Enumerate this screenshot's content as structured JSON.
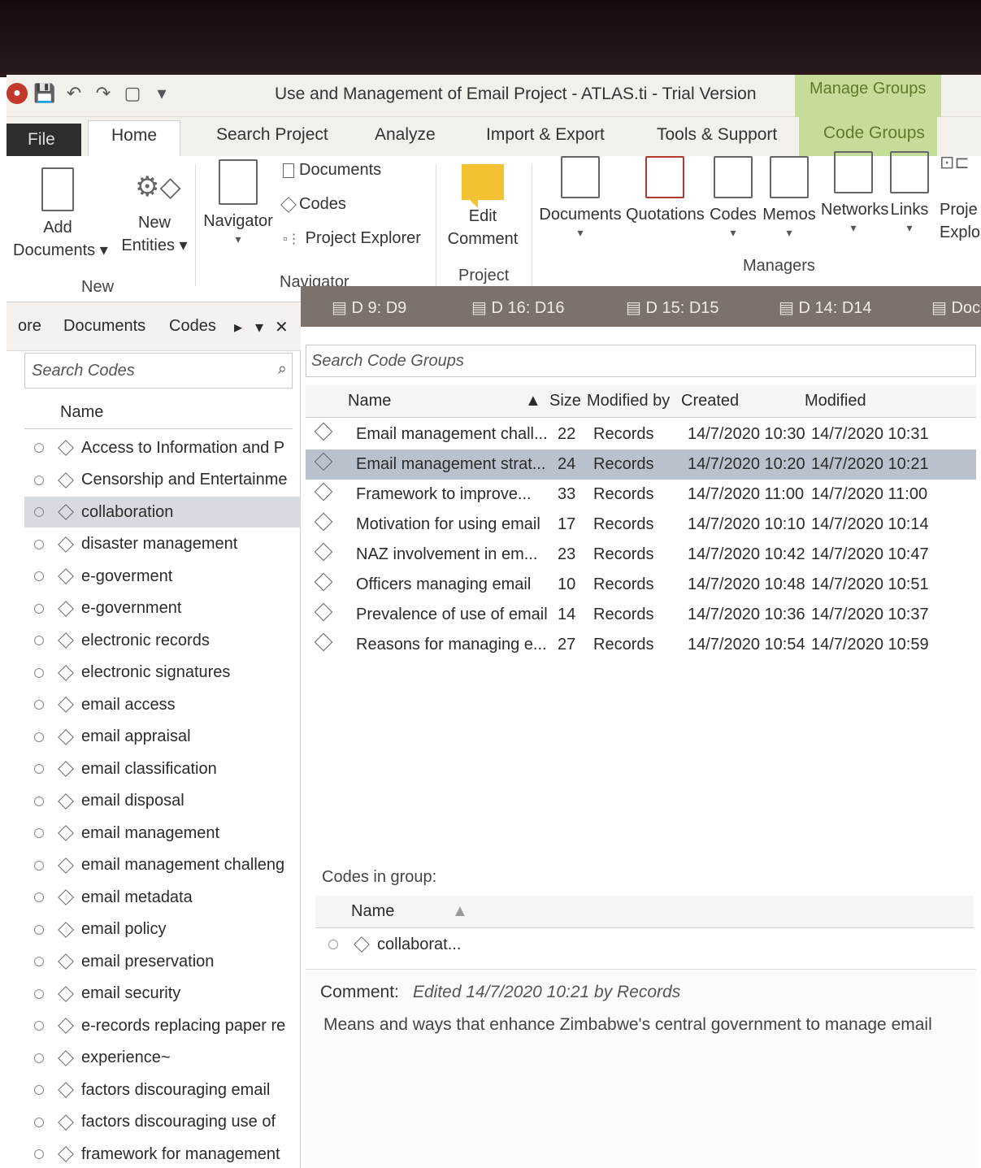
{
  "window": {
    "title": "Use and Management of Email Project - ATLAS.ti - Trial Version",
    "context_label": "Manage Groups"
  },
  "tabs": {
    "file": "File",
    "home": "Home",
    "search_project": "Search Project",
    "analyze": "Analyze",
    "import_export": "Import & Export",
    "tools_support": "Tools & Support",
    "code_groups": "Code Groups"
  },
  "ribbon": {
    "add_documents": "Add",
    "add_documents_2": "Documents",
    "new_entities": "New",
    "new_entities_2": "Entities",
    "group_new": "New",
    "navigator": "Navigator",
    "nav_documents": "Documents",
    "nav_codes": "Codes",
    "nav_project_explorer": "Project Explorer",
    "group_navigator": "Navigator",
    "edit_comment": "Edit",
    "edit_comment_2": "Comment",
    "group_project": "Project",
    "mgr_documents": "Documents",
    "mgr_quotations": "Quotations",
    "mgr_codes": "Codes",
    "mgr_memos": "Memos",
    "mgr_networks": "Networks",
    "mgr_links": "Links",
    "mgr_project_explorer": "Proje",
    "mgr_project_explorer_2": "Explo",
    "group_managers": "Managers"
  },
  "left_pane": {
    "tabs": [
      "ore",
      "Documents",
      "Codes"
    ],
    "search_placeholder": "Search Codes",
    "column_name": "Name",
    "codes": [
      "Access to Information and P",
      "Censorship and Entertainme",
      "collaboration",
      "disaster management",
      "e-goverment",
      "e-government",
      "electronic records",
      "electronic signatures",
      "email access",
      "email appraisal",
      "email classification",
      "email disposal",
      "email management",
      "email management challeng",
      "email metadata",
      "email policy",
      "email preservation",
      "email security",
      "e-records replacing paper re",
      "experience~",
      "factors discouraging email",
      "factors discouraging use of",
      "framework for management"
    ],
    "selected_code": "collaboration"
  },
  "doc_tabs": [
    "D 9: D9",
    "D 16: D16",
    "D 15: D15",
    "D 14: D14",
    "Doc"
  ],
  "manager": {
    "search_placeholder": "Search Code Groups",
    "columns": {
      "name": "Name",
      "size": "Size",
      "modified_by": "Modified by",
      "created": "Created",
      "modified": "Modified"
    },
    "rows": [
      {
        "name": "Email management chall...",
        "size": "22",
        "modified_by": "Records",
        "created": "14/7/2020 10:30",
        "modified": "14/7/2020 10:31"
      },
      {
        "name": "Email management strat...",
        "size": "24",
        "modified_by": "Records",
        "created": "14/7/2020 10:20",
        "modified": "14/7/2020 10:21"
      },
      {
        "name": "Framework to improve...",
        "size": "33",
        "modified_by": "Records",
        "created": "14/7/2020 11:00",
        "modified": "14/7/2020 11:00"
      },
      {
        "name": "Motivation for using email",
        "size": "17",
        "modified_by": "Records",
        "created": "14/7/2020 10:10",
        "modified": "14/7/2020 10:14"
      },
      {
        "name": "NAZ involvement in em...",
        "size": "23",
        "modified_by": "Records",
        "created": "14/7/2020 10:42",
        "modified": "14/7/2020 10:47"
      },
      {
        "name": "Officers managing email",
        "size": "10",
        "modified_by": "Records",
        "created": "14/7/2020 10:48",
        "modified": "14/7/2020 10:51"
      },
      {
        "name": "Prevalence of use of email",
        "size": "14",
        "modified_by": "Records",
        "created": "14/7/2020 10:36",
        "modified": "14/7/2020 10:37"
      },
      {
        "name": "Reasons for managing e...",
        "size": "27",
        "modified_by": "Records",
        "created": "14/7/2020 10:54",
        "modified": "14/7/2020 10:59"
      }
    ],
    "codes_in_group_label": "Codes in group:",
    "codes_in_group_column": "Name",
    "codes_in_group": [
      "collaborat..."
    ],
    "comment_label": "Comment:",
    "comment_meta": "Edited 14/7/2020 10:21 by Records",
    "comment_text": "Means and ways that enhance Zimbabwe's central government to manage email"
  },
  "colors": {
    "accent_green": "#c6dd9a",
    "selected_row": "#b9c2cc",
    "doc_strip": "#7c726c"
  }
}
